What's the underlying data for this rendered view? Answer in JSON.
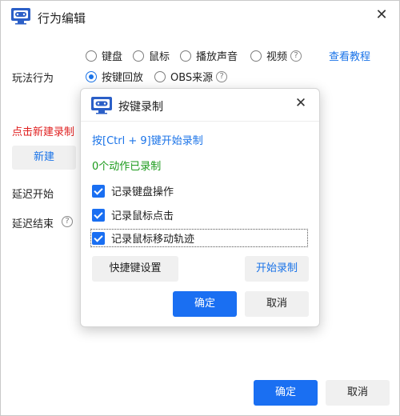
{
  "window": {
    "title": "行为编辑",
    "close": "✕"
  },
  "play_behavior": {
    "label": "玩法行为",
    "options_row1": [
      "键盘",
      "鼠标",
      "播放声音",
      "视频"
    ],
    "options_row2": [
      "按键回放",
      "OBS来源"
    ],
    "selected": "按键回放",
    "help": "?",
    "tutorial_link": "查看教程"
  },
  "new_record": {
    "label": "点击新建录制",
    "button": "新建"
  },
  "delay": {
    "start_label": "延迟开始",
    "end_label": "延迟结束"
  },
  "dialog": {
    "title": "按键录制",
    "close": "✕",
    "shortcut_hint": "按[Ctrl + 9]键开始录制",
    "status": "0个动作已录制",
    "checkboxes": [
      {
        "label": "记录键盘操作",
        "checked": true
      },
      {
        "label": "记录鼠标点击",
        "checked": true
      },
      {
        "label": "记录鼠标移动轨迹",
        "checked": true
      }
    ],
    "hotkey_settings": "快捷键设置",
    "start_record": "开始录制",
    "ok": "确定",
    "cancel": "取消"
  },
  "footer": {
    "ok": "确定",
    "cancel": "取消"
  },
  "colors": {
    "accent": "#1a73e8",
    "primary_button": "#1a6ff2",
    "warning": "#e02020",
    "success": "#1a9a1a"
  }
}
